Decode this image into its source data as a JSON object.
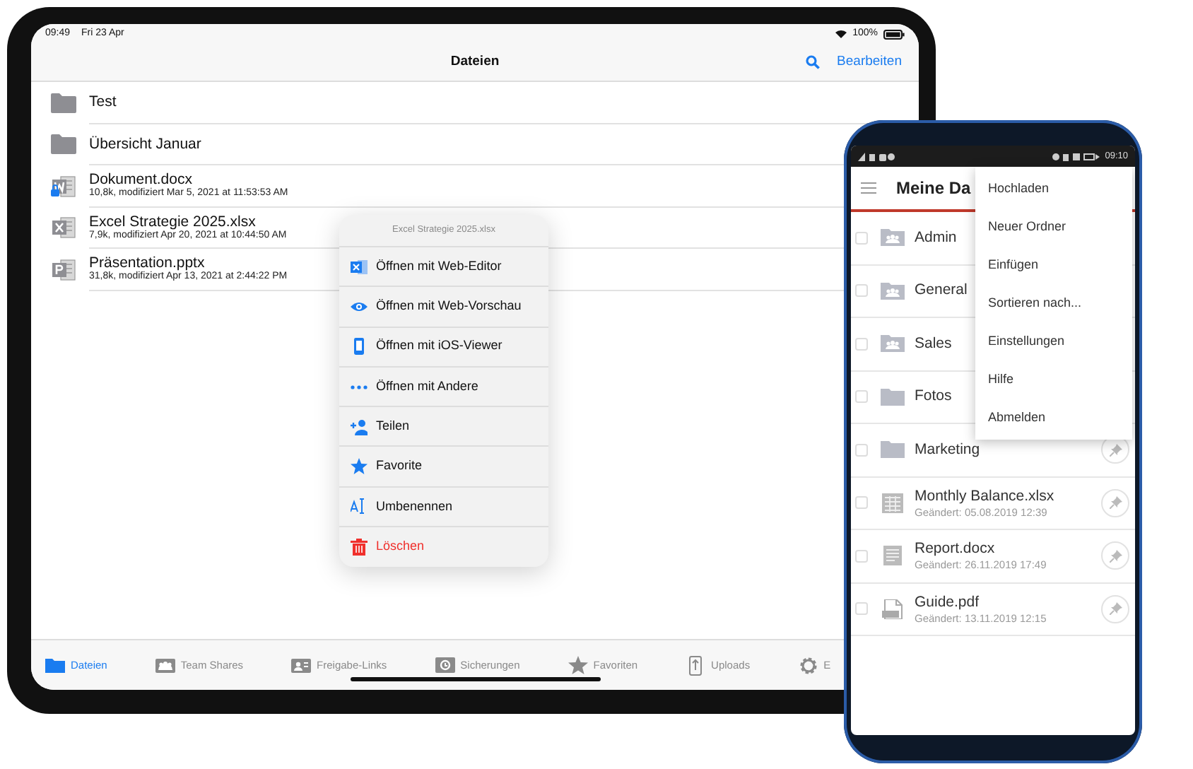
{
  "tablet": {
    "status_bar": {
      "time": "09:49",
      "date": "Fri 23 Apr",
      "battery": "100%"
    },
    "nav_bar": {
      "title": "Dateien",
      "action": "Bearbeiten"
    },
    "files": [
      {
        "kind": "folder",
        "name": "Test"
      },
      {
        "kind": "folder",
        "name": "Übersicht Januar"
      },
      {
        "kind": "word",
        "name": "Dokument.docx",
        "details": "10,8k, modifiziert Mar 5, 2021 at 11:53:53 AM"
      },
      {
        "kind": "excel",
        "name": "Excel Strategie 2025.xlsx",
        "details": "7,9k, modifiziert Apr 20, 2021 at 10:44:50 AM"
      },
      {
        "kind": "powerpoint",
        "name": "Präsentation.pptx",
        "details": "31,8k, modifiziert Apr 13, 2021 at 2:44:22 PM"
      }
    ],
    "context_menu": {
      "title": "Excel Strategie 2025.xlsx",
      "items": [
        {
          "kind": "editor",
          "label": "Öffnen mit Web-Editor"
        },
        {
          "kind": "preview",
          "label": "Öffnen mit Web-Vorschau"
        },
        {
          "kind": "viewer",
          "label": "Öffnen mit iOS-Viewer"
        },
        {
          "kind": "more",
          "label": "Öffnen mit Andere"
        },
        {
          "kind": "share",
          "label": "Teilen"
        },
        {
          "kind": "favorite",
          "label": "Favorite"
        },
        {
          "kind": "rename",
          "label": "Umbenennen"
        },
        {
          "kind": "delete",
          "label": "Löschen"
        }
      ]
    },
    "tab_bar": [
      {
        "kind": "folder",
        "label": "Dateien",
        "selected": true
      },
      {
        "kind": "team",
        "label": "Team Shares",
        "selected": false
      },
      {
        "kind": "links",
        "label": "Freigabe-Links",
        "selected": false
      },
      {
        "kind": "backup",
        "label": "Sicherungen",
        "selected": false
      },
      {
        "kind": "star",
        "label": "Favoriten",
        "selected": false
      },
      {
        "kind": "upload",
        "label": "Uploads",
        "selected": false
      },
      {
        "kind": "gear",
        "label": "E",
        "selected": false
      }
    ]
  },
  "phone": {
    "status_bar": {
      "time": "09:10"
    },
    "app_bar": {
      "title": "Meine Da"
    },
    "menu": [
      "Hochladen",
      "Neuer Ordner",
      "Einfügen",
      "Sortieren nach...",
      "Einstellungen",
      "Hilfe",
      "Abmelden"
    ],
    "items": [
      {
        "kind": "team-folder",
        "name": "Admin",
        "checked": false,
        "pin_button": false
      },
      {
        "kind": "team-folder",
        "name": "General",
        "checked": false,
        "pin_button": false
      },
      {
        "kind": "team-folder",
        "name": "Sales",
        "checked": false,
        "pin_button": false
      },
      {
        "kind": "folder",
        "name": "Fotos",
        "checked": false,
        "pin_button": false
      },
      {
        "kind": "folder",
        "name": "Marketing",
        "checked": false,
        "pin_button": true
      },
      {
        "kind": "sheet",
        "name": "Monthly Balance.xlsx",
        "modified": "Geändert: 05.08.2019 12:39",
        "checked": false,
        "pin_button": true
      },
      {
        "kind": "doc",
        "name": "Report.docx",
        "modified": "Geändert: 26.11.2019 17:49",
        "checked": false,
        "pin_button": true
      },
      {
        "kind": "pdf",
        "name": "Guide.pdf",
        "modified": "Geändert: 13.11.2019 12:15",
        "checked": false,
        "pin_button": true
      }
    ]
  }
}
